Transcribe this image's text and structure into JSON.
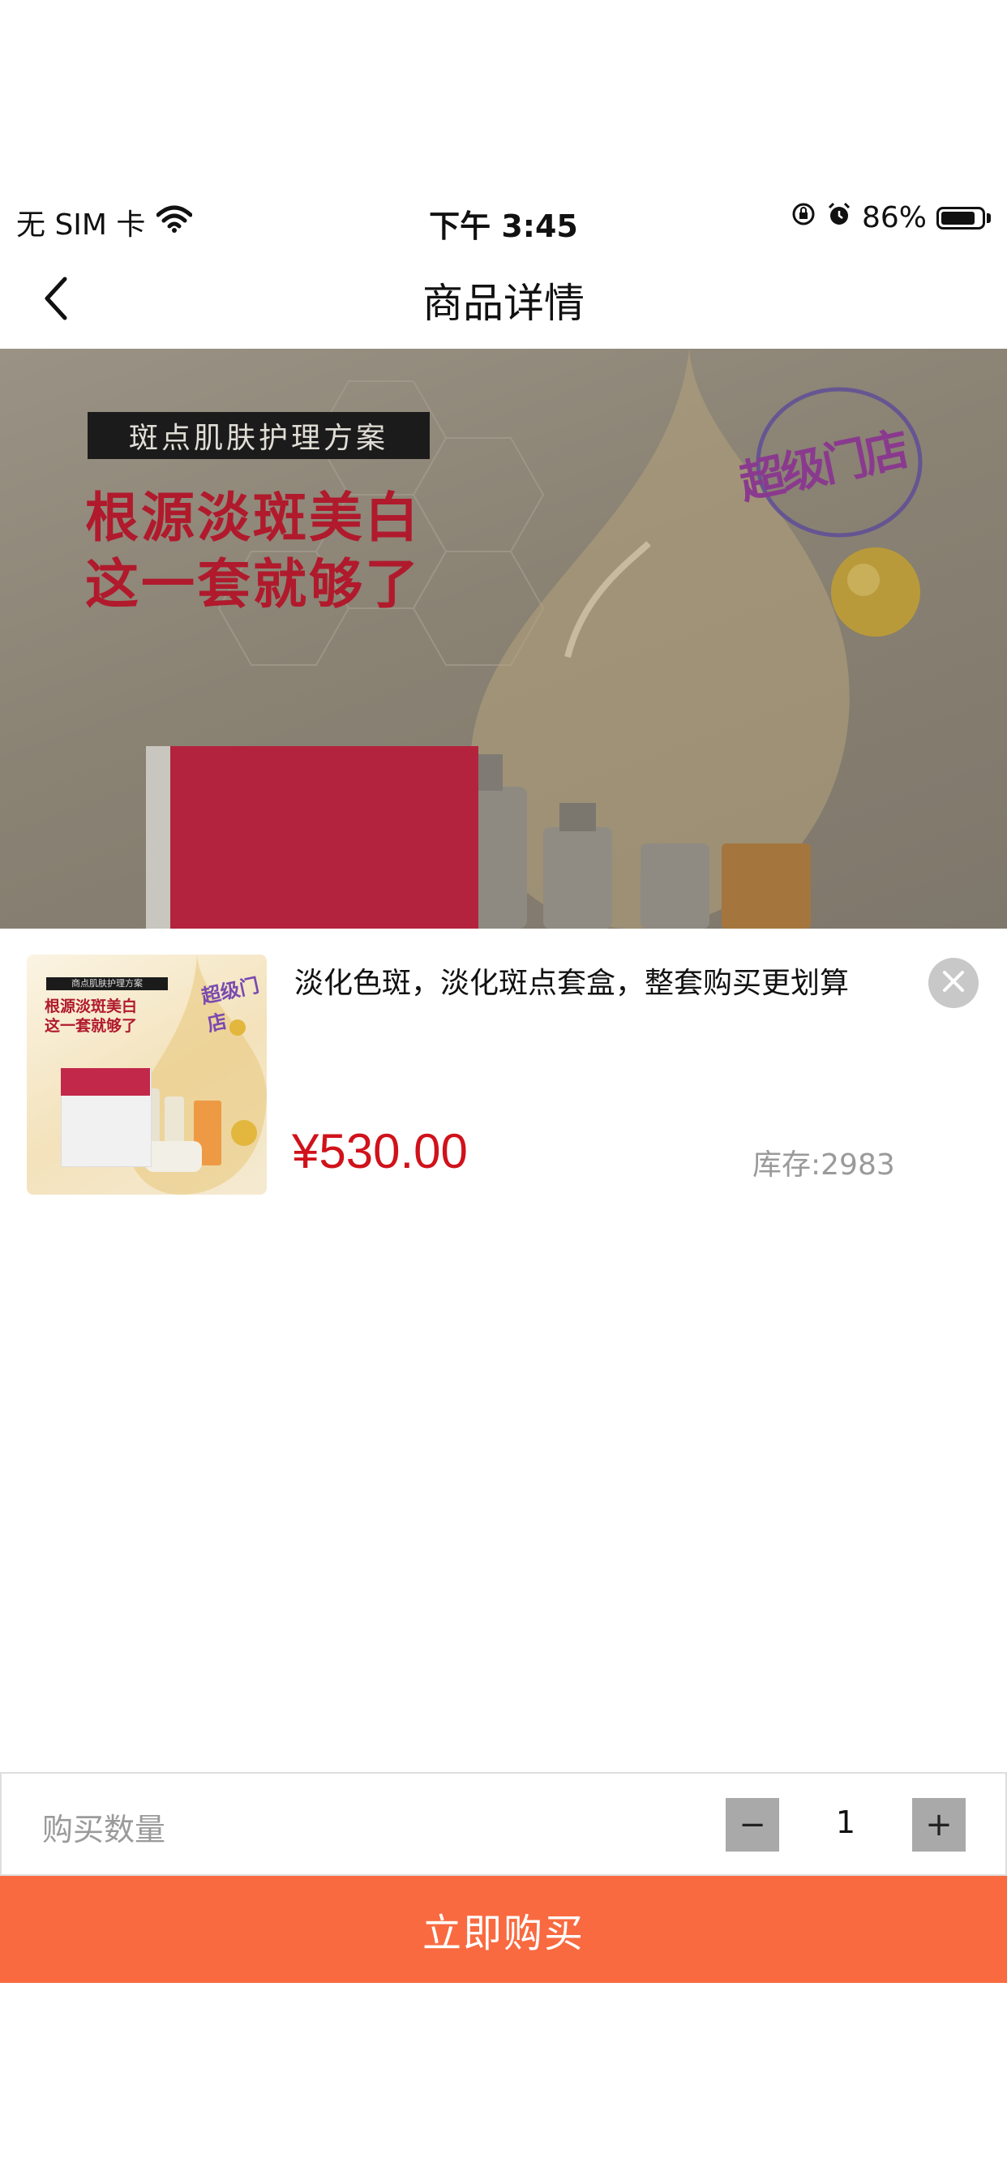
{
  "status_bar": {
    "carrier": "无 SIM 卡",
    "time": "下午 3:45",
    "battery_percent": "86%",
    "battery_level": 0.86,
    "icons": [
      "wifi-icon",
      "orientation-lock-icon",
      "alarm-icon",
      "battery-icon"
    ]
  },
  "nav": {
    "title": "商品详情",
    "back_icon": "chevron-left-icon"
  },
  "banner": {
    "tag": "斑点肌肤护理方案",
    "headline_1": "根源淡斑美白",
    "headline_2": "这一套就够了",
    "logo_text": "超级门店"
  },
  "sku": {
    "title": "淡化色斑，淡化斑点套盒，整套购买更划算",
    "price": "¥530.00",
    "stock": "库存:2983",
    "close_icon": "close-icon",
    "thumb": {
      "tag": "商点肌肤护理方案",
      "headline_1": "根源淡斑美白",
      "headline_2": "这一套就够了"
    }
  },
  "quantity": {
    "label": "购买数量",
    "value": "1",
    "minus": "−",
    "plus": "+"
  },
  "buy": {
    "label": "立即购买"
  },
  "colors": {
    "accent": "#f96a40",
    "price": "#d0121b",
    "headline": "#b01a2c"
  }
}
